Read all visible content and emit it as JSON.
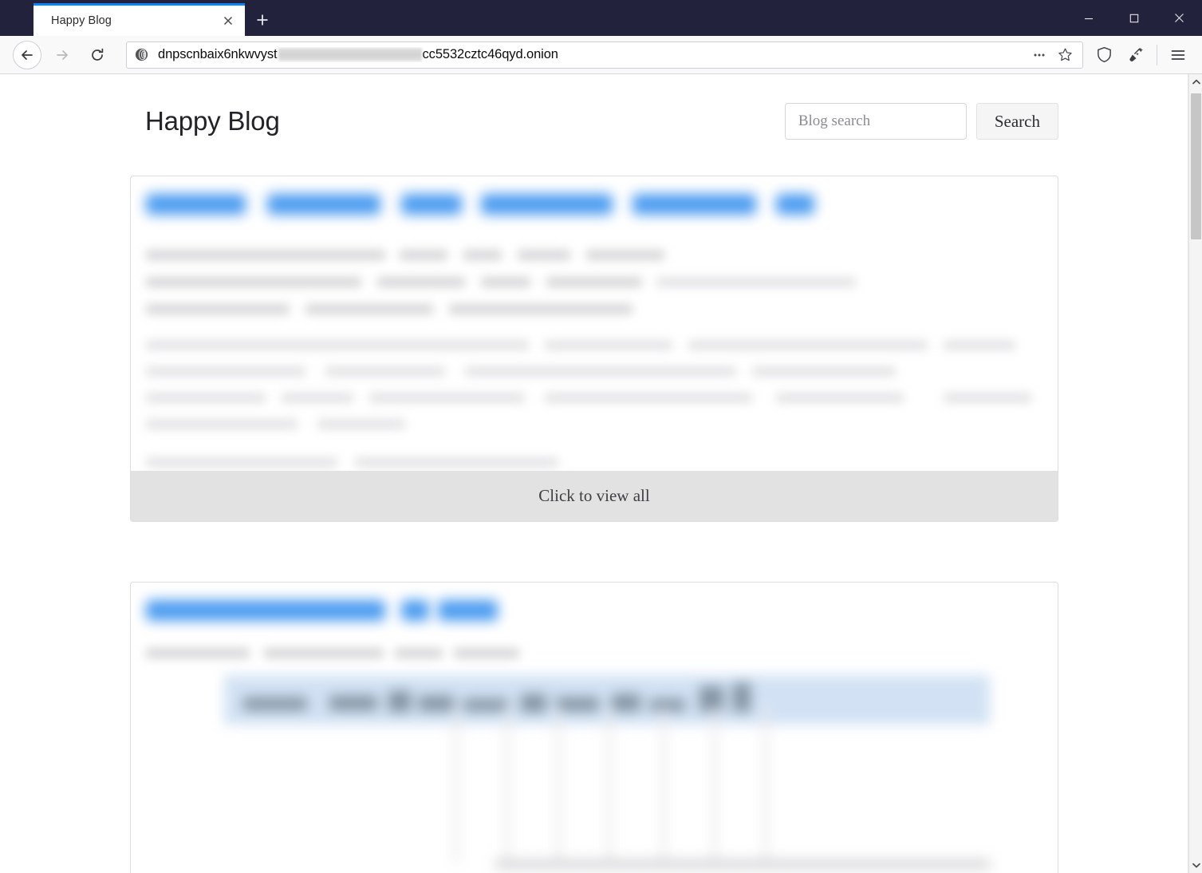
{
  "browser": {
    "window_controls": {
      "minimize": "minimize-button",
      "maximize": "maximize-button",
      "close": "close-button"
    },
    "tabs": [
      {
        "title": "Happy Blog",
        "active": true,
        "close_label": "Close tab"
      }
    ],
    "new_tab_label": "+",
    "navigation": {
      "back": "Go back",
      "forward": "Go forward",
      "reload": "Reload"
    },
    "urlbar": {
      "security_icon": "onion-icon",
      "url_prefix": "dnpscnbaix6nkwvyst",
      "url_redacted": true,
      "url_suffix": "cc5532cztc46qyd.onion",
      "full_url": "dnpscnbaix6nkwvyst[redacted]cc5532cztc46qyd.onion",
      "page_actions_label": "…",
      "bookmark_label": "Bookmark this page"
    },
    "toolbar_icons": [
      {
        "name": "ellipsis-icon",
        "label": "…"
      },
      {
        "name": "bookmark-star-icon",
        "label": "Bookmark"
      },
      {
        "name": "shield-icon",
        "label": "Security settings"
      },
      {
        "name": "new-identity-broom-icon",
        "label": "New Identity"
      },
      {
        "name": "hamburger-menu-icon",
        "label": "Open application menu"
      }
    ]
  },
  "page": {
    "site_title": "Happy Blog",
    "search": {
      "placeholder": "Blog search",
      "value": "",
      "button_label": "Search"
    },
    "posts": [
      {
        "id": "post-1",
        "title_redacted": true,
        "body_redacted": true,
        "footer_label": "Click to view all"
      },
      {
        "id": "post-2",
        "title_redacted": true,
        "body_redacted": true,
        "has_table_image": true
      }
    ]
  },
  "colors": {
    "titlebar": "#23223c",
    "tab_active_accent": "#0a84ff",
    "toolbar": "#f9f9fa",
    "link_blue": "#4c9cf0",
    "card_border": "#dedee1",
    "footer_bar": "#e2e2e2",
    "table_header_blue": "#d2e2f4"
  },
  "scrollbar": {
    "up_arrow": "scroll-up",
    "down_arrow": "scroll-down",
    "position_percent": 2
  }
}
